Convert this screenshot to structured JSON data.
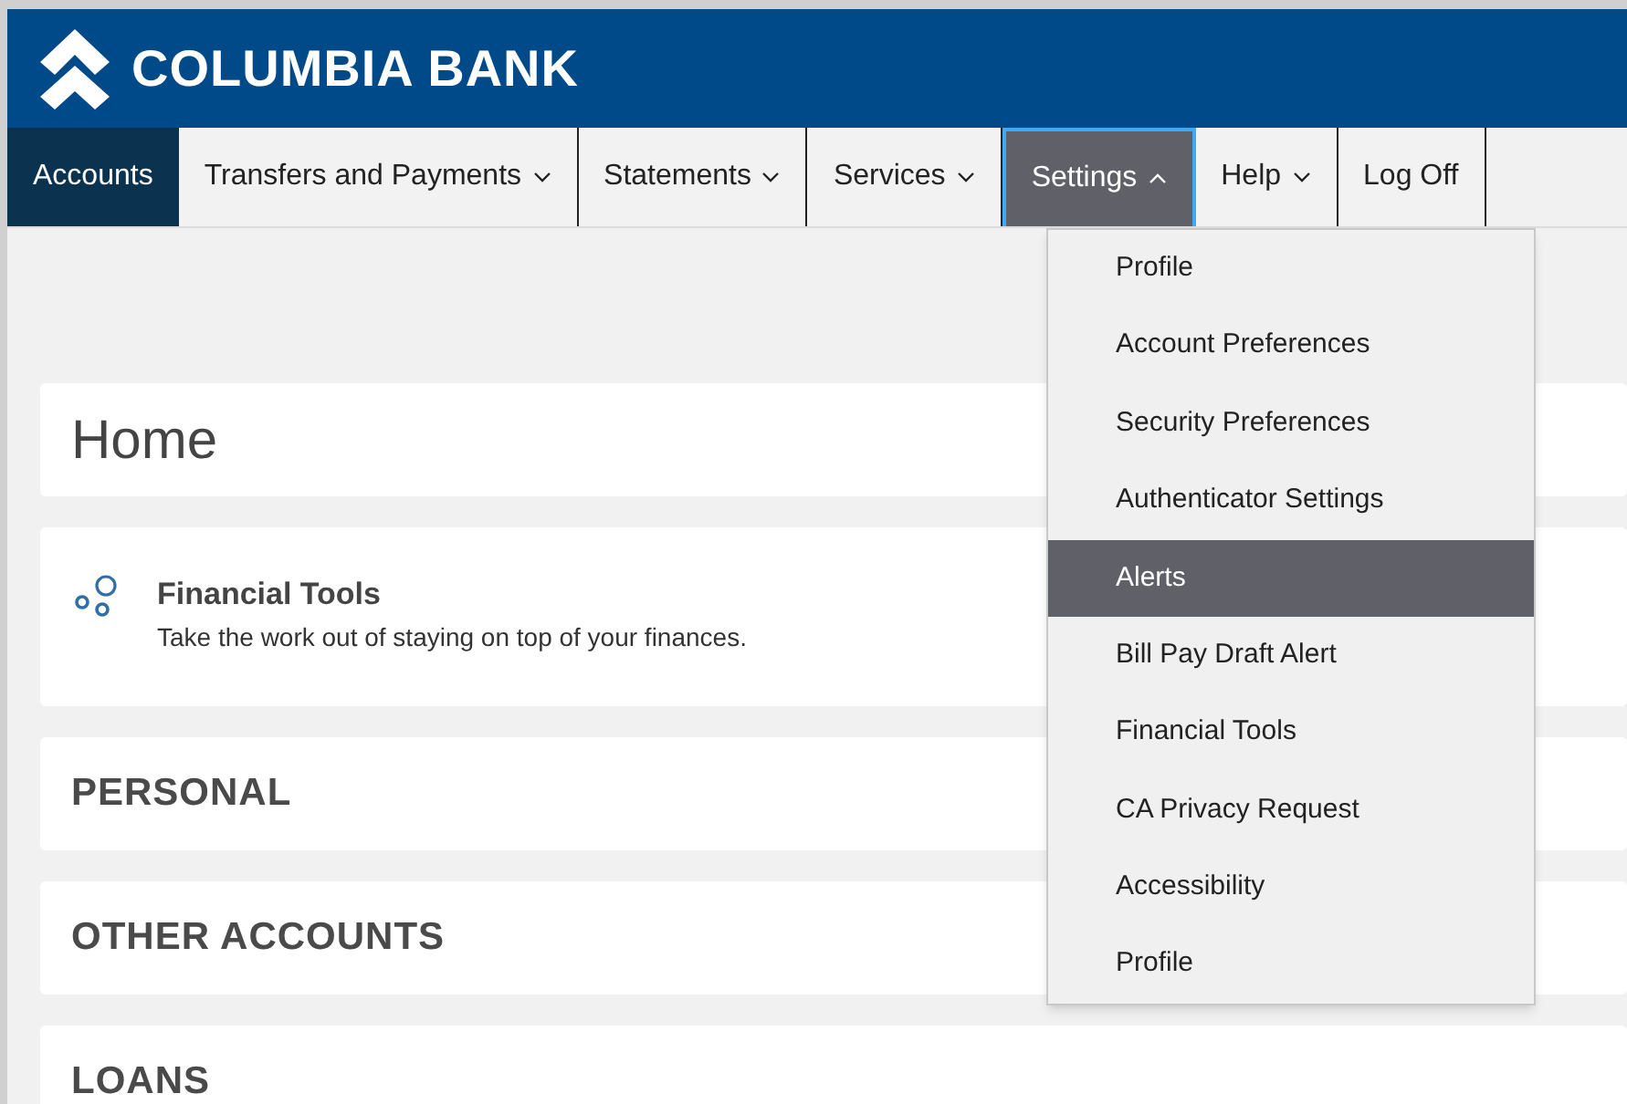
{
  "brand": {
    "name": "COLUMBIA BANK"
  },
  "nav": [
    {
      "label": "Accounts",
      "kind": "link",
      "selected": true,
      "expanded": false
    },
    {
      "label": "Transfers and Payments",
      "kind": "menu",
      "selected": false,
      "expanded": false
    },
    {
      "label": "Statements",
      "kind": "menu",
      "selected": false,
      "expanded": false
    },
    {
      "label": "Services",
      "kind": "menu",
      "selected": false,
      "expanded": false
    },
    {
      "label": "Settings",
      "kind": "menu",
      "selected": false,
      "expanded": true
    },
    {
      "label": "Help",
      "kind": "menu",
      "selected": false,
      "expanded": false
    },
    {
      "label": "Log Off",
      "kind": "link",
      "selected": false,
      "expanded": false
    }
  ],
  "settings_menu": [
    {
      "label": "Profile",
      "selected": false
    },
    {
      "label": "Account Preferences",
      "selected": false
    },
    {
      "label": "Security Preferences",
      "selected": false
    },
    {
      "label": "Authenticator Settings",
      "selected": false
    },
    {
      "label": "Alerts",
      "selected": true
    },
    {
      "label": "Bill Pay Draft Alert",
      "selected": false
    },
    {
      "label": "Financial Tools",
      "selected": false
    },
    {
      "label": "CA Privacy Request",
      "selected": false
    },
    {
      "label": "Accessibility",
      "selected": false
    },
    {
      "label": "Profile",
      "selected": false
    }
  ],
  "page_title": "Home",
  "financial_tools": {
    "title": "Financial Tools",
    "description": "Take the work out of staying on top of your finances."
  },
  "sections": [
    "PERSONAL",
    "OTHER ACCOUNTS",
    "LOANS"
  ]
}
